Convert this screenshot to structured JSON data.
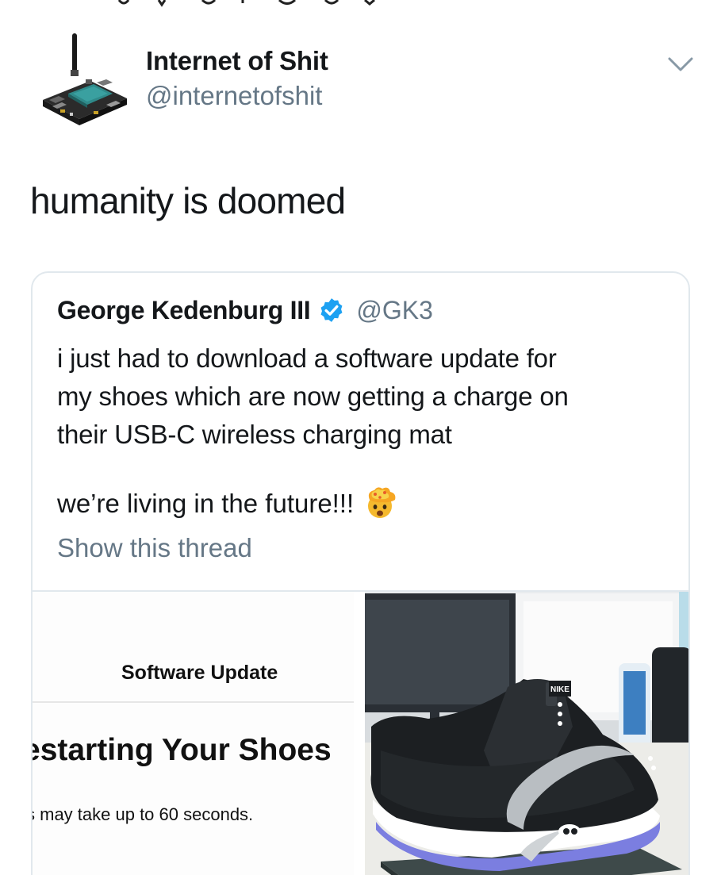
{
  "author": {
    "name": "Internet of Shit",
    "handle": "@internetofshit"
  },
  "tweet": {
    "text": "humanity is doomed"
  },
  "quoted_tweet": {
    "name": "George Kedenburg III",
    "handle": "@GK3",
    "lines": [
      "i just had to download a software update for",
      "my shoes which are now getting a charge on",
      "their USB-C wireless charging mat"
    ],
    "line2": "we’re living in the future!!!",
    "show_thread": "Show this thread"
  },
  "media_left": {
    "title": "Software Update",
    "heading": "estarting Your Shoes",
    "subtext": "s may take up to 60 seconds."
  },
  "media_right": {
    "brand_label": "NIKE"
  },
  "colors": {
    "text": "#14171a",
    "secondary": "#657786",
    "border": "#e1e8ed",
    "verified": "#1da1f2"
  },
  "icons": {
    "menu": "chevron-down-icon",
    "verified": "verified-badge-icon",
    "emoji": "exploding-head-emoji-icon"
  }
}
